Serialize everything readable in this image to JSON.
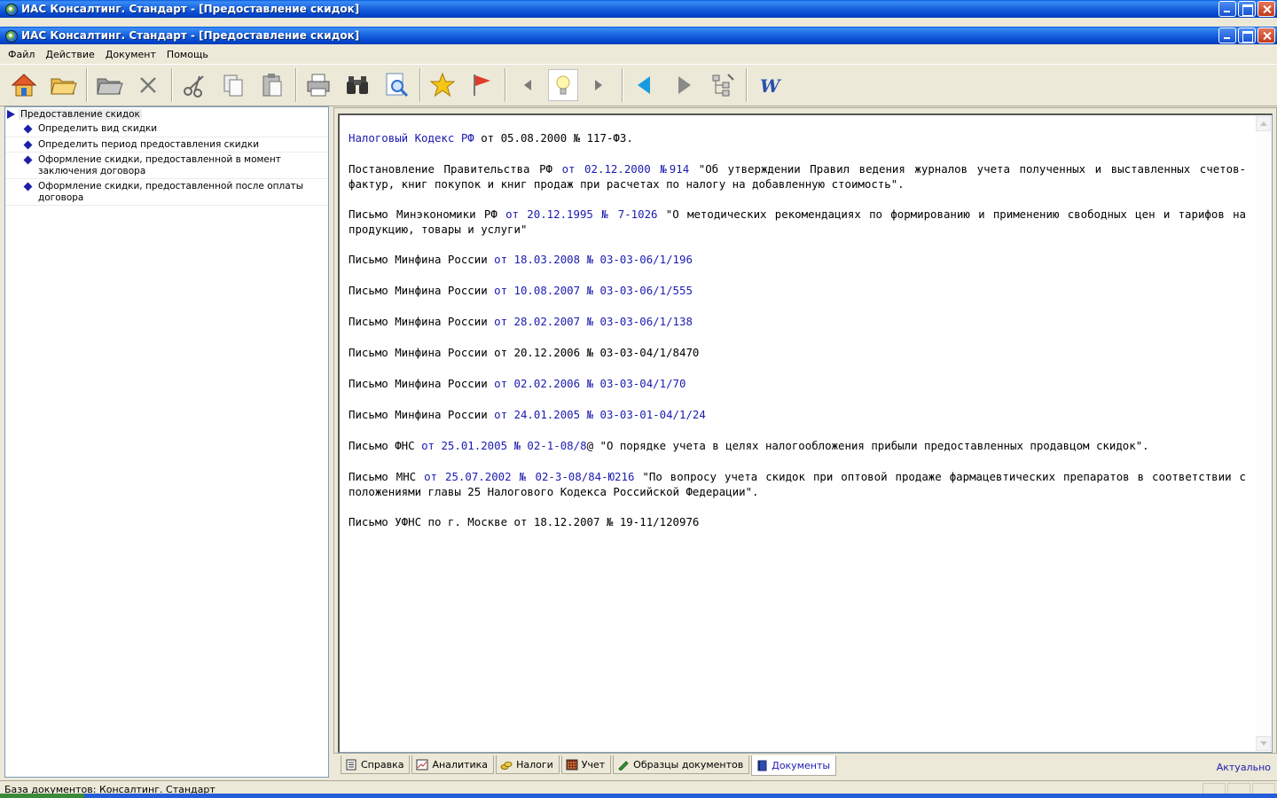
{
  "window": {
    "outer_title": "ИАС Консалтинг. Стандарт - [Предоставление скидок]",
    "inner_title": "ИАС Консалтинг. Стандарт - [Предоставление скидок]"
  },
  "menu": [
    "Файл",
    "Действие",
    "Документ",
    "Помощь"
  ],
  "toolbar": {
    "icons": [
      "home-icon",
      "open-folder-icon",
      "folder-icon",
      "delete-icon",
      "scissors-icon",
      "copy-icon",
      "paste-icon",
      "print-icon",
      "binoculars-icon",
      "preview-icon",
      "star-icon",
      "flag-icon",
      "back-icon",
      "bulb-icon",
      "forward-icon",
      "prev-blue-icon",
      "next-icon",
      "tree-icon",
      "word-icon"
    ]
  },
  "tree": {
    "root": "Предоставление скидок",
    "items": [
      "Определить вид скидки",
      "Определить период предоставления скидки",
      "Оформление скидки, предоставленной в момент заключения договора",
      "Оформление скидки, предоставленной после оплаты договора"
    ]
  },
  "document": {
    "p1_link": "Налоговый Кодекс РФ",
    "p1_text": " от 05.08.2000 № 117-ФЗ.",
    "p2_pre": "Постановление Правительства РФ ",
    "p2_link": "от 02.12.2000 №914",
    "p2_text": " \"Об утверждении Правил ведения журналов учета полученных и выставленных счетов-фактур, книг покупок и книг продаж при расчетах по налогу на добавленную стоимость\".",
    "p3_pre": "Письмо Минэкономики РФ ",
    "p3_link": "от 20.12.1995 № 7-1026",
    "p3_text": " \"О методических рекомендациях по формированию  и применению свободных цен и тарифов на продукцию, товары и услуги\"",
    "p4_pre": "Письмо Минфина России ",
    "p4_link": "от 18.03.2008 № 03-03-06/1/196",
    "p5_pre": "Письмо Минфина России ",
    "p5_link": "от 10.08.2007 № 03-03-06/1/555",
    "p6_pre": "Письмо Минфина России ",
    "p6_link": "от 28.02.2007 № 03-03-06/1/138",
    "p7_text": "Письмо Минфина России от 20.12.2006 № 03-03-04/1/8470",
    "p8_pre": "Письмо Минфина России ",
    "p8_link": "от 02.02.2006 № 03-03-04/1/70",
    "p9_pre": "Письмо Минфина России ",
    "p9_link": "от 24.01.2005 № 03-03-01-04/1/24",
    "p10_pre": "Письмо ФНС ",
    "p10_link": "от 25.01.2005 № 02-1-08/8",
    "p10_text": "@ \"О порядке учета в целях налогообложения прибыли предоставленных продавцом скидок\".",
    "p11_pre": "Письмо МНС ",
    "p11_link": "от 25.07.2002 № 02-3-08/84-Ю216",
    "p11_text": " \"По вопросу учета скидок при оптовой продаже фармацевтических препаратов в соответствии с положениями главы 25 Налогового Кодекса Российской Федерации\".",
    "p12_text": "Письмо УФНС по г. Москве от 18.12.2007 № 19-11/120976"
  },
  "tabs": [
    "Справка",
    "Аналитика",
    "Налоги",
    "Учет",
    "Образцы документов",
    "Документы"
  ],
  "active_tab": "Документы",
  "status_right": "Актуально",
  "statusbar": "База документов: Консалтинг. Стандарт",
  "colors": {
    "link": "#1b1bb0",
    "titlebar": "#0548d0",
    "tree_marker": "#1c20a8"
  }
}
